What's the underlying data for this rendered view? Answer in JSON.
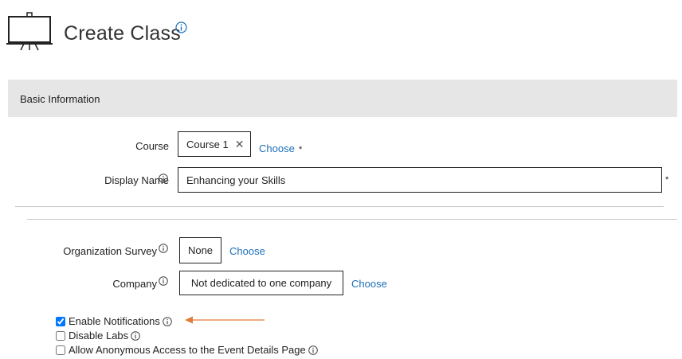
{
  "header": {
    "title": "Create Class",
    "icon": "presentation-board-icon"
  },
  "section": {
    "title": "Basic Information"
  },
  "form": {
    "course": {
      "label": "Course",
      "value": "Course 1",
      "choose_label": "Choose",
      "required_mark": "*"
    },
    "display_name": {
      "label": "Display Name",
      "value": "Enhancing your Skills",
      "required_mark": "*"
    },
    "organization_survey": {
      "label": "Organization Survey",
      "value": "None",
      "choose_label": "Choose"
    },
    "company": {
      "label": "Company",
      "value": "Not dedicated to one company",
      "choose_label": "Choose"
    },
    "checkboxes": [
      {
        "label": "Enable Notifications",
        "checked": true
      },
      {
        "label": "Disable Labs",
        "checked": false
      },
      {
        "label": "Allow Anonymous Access to the Event Details Page",
        "checked": false
      }
    ]
  },
  "colors": {
    "link": "#1c6fb7",
    "section_bg": "#e6e6e6",
    "arrow": "#e07b39"
  }
}
